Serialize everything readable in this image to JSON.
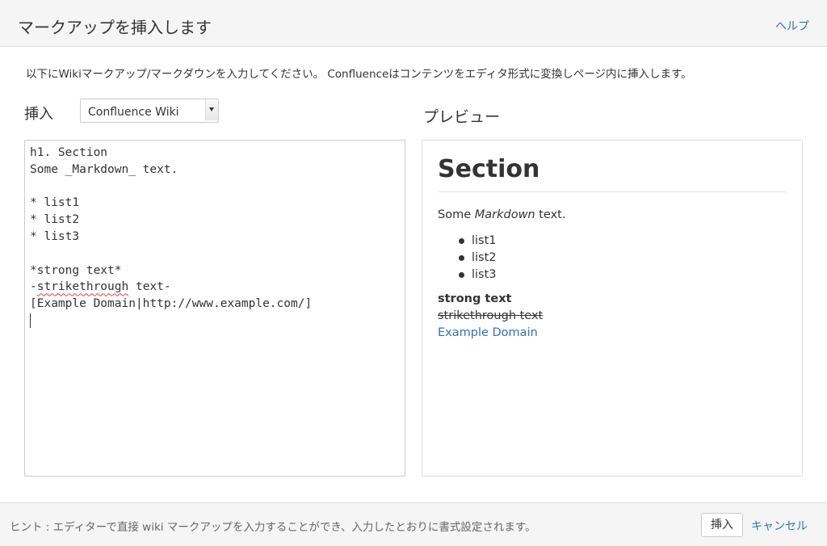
{
  "header": {
    "title": "マークアップを挿入します",
    "help_label": "ヘルプ"
  },
  "description": "以下にWikiマークアップ/マークダウンを入力してください。 Confluenceはコンテンツをエディタ形式に変換しページ内に挿入します。",
  "insert_section": {
    "label": "挿入",
    "format_selected": "Confluence Wiki"
  },
  "preview_section": {
    "label": "プレビュー"
  },
  "editor": {
    "lines": [
      "h1. Section",
      "Some _Markdown_ text.",
      "",
      "* list1",
      "* list2",
      "* list3",
      "",
      "*strong text*",
      "-",
      "strikethrough",
      " text-",
      "[Example Domain|http://www.example.com/]"
    ]
  },
  "preview": {
    "heading": "Section",
    "paragraph_before": "Some ",
    "paragraph_emphasis": "Markdown",
    "paragraph_after": " text.",
    "list_items": [
      "list1",
      "list2",
      "list3"
    ],
    "strong_text": "strong text",
    "strikethrough_text": "strikethrough text",
    "link_text": "Example Domain"
  },
  "footer": {
    "hint": "ヒント : エディターで直接 wiki マークアップを入力することができ、入力したとおりに書式設定されます。",
    "insert_button": "挿入",
    "cancel_label": "キャンセル"
  },
  "colors": {
    "link": "#3572b0",
    "header_background": "#f5f5f5",
    "spell_error": "#e0443e"
  }
}
